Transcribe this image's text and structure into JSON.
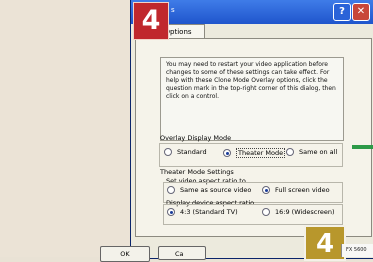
{
  "background_text": [
    "",
    "",
    "",
    "",
    "",
    "",
    "",
    "",
    "",
    "",
    "",
    "",
    "",
    "",
    "",
    "",
    "",
    "",
    "",
    "",
    "",
    "",
    "",
    ""
  ],
  "window": {
    "title": "s",
    "tab_label": "e Options",
    "help_icon": "question-icon",
    "close_icon": "close-icon"
  },
  "info": {
    "text": "You may need to restart your video application before changes to some of these settings can take effect. For help with these Clone Mode Overlay options, click the question mark in the top-right corner of this dialog, then click on a control."
  },
  "overlay_mode": {
    "title": "Overlay Display Mode",
    "options": [
      "Standard",
      "Theater Mode",
      "Same on all"
    ],
    "selected": "Theater Mode"
  },
  "theater_settings": {
    "title": "Theater Mode Settings",
    "video_aspect": {
      "title": "Set video aspect ratio to",
      "options": [
        "Same as source video",
        "Full screen video"
      ],
      "selected": "Full screen video"
    },
    "device_aspect": {
      "title": "Display device aspect ratio",
      "options": [
        "4:3 (Standard TV)",
        "16:9 (Widescreen)"
      ],
      "selected": "4:3 (Standard TV)"
    }
  },
  "buttons": {
    "ok": "OK",
    "cancel": "Ca"
  },
  "badges": {
    "top": "4",
    "bottom": "4"
  },
  "popup": {
    "text": "FX 5600"
  },
  "colors": {
    "badge_red": "#c0282d",
    "badge_gold": "#b8972c",
    "titlebar_blue": "#1f55cc",
    "arrow_green": "#2d9a48"
  }
}
